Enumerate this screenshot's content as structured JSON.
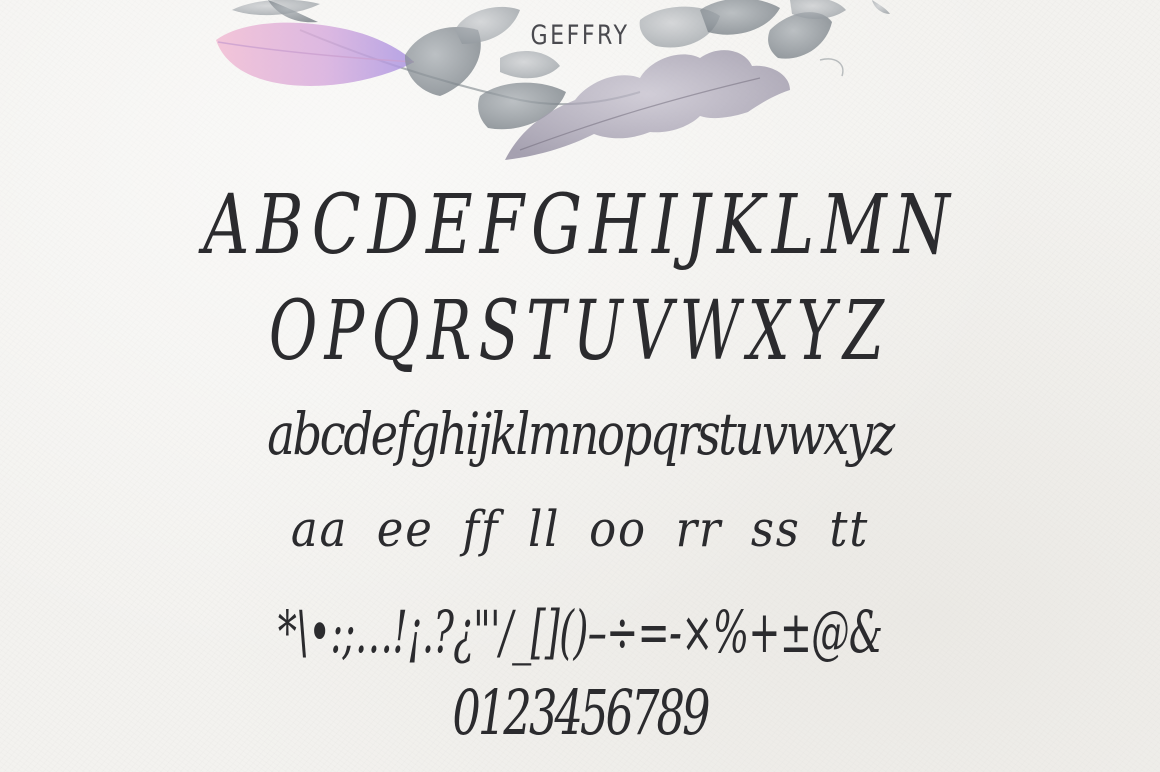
{
  "brand": {
    "name": "GEFFRY"
  },
  "specimen": {
    "uppercase_row_1": "ABCDEFGHIJKLMN",
    "uppercase_row_2": "OPQRSTUVWXYZ",
    "lowercase": "abcdefghijklmnopqrstuvwxyz",
    "ligatures": "aa ee ff ll oo rr ss tt",
    "punctuation": "*\\•:;…!¡.?¿\"'/_[]()–÷=-×%+±@&",
    "numerals": "0123456789"
  },
  "colors": {
    "background": "#f3f2ef",
    "ink": "#2b2b2e",
    "leaf_gray": "#8f969c",
    "feather_pink": "#e7a9c7",
    "feather_lavender": "#b29ee0"
  },
  "decoration": {
    "wreath": "watercolor-leaf-wreath-icon",
    "feather": "watercolor-feather-icon"
  }
}
